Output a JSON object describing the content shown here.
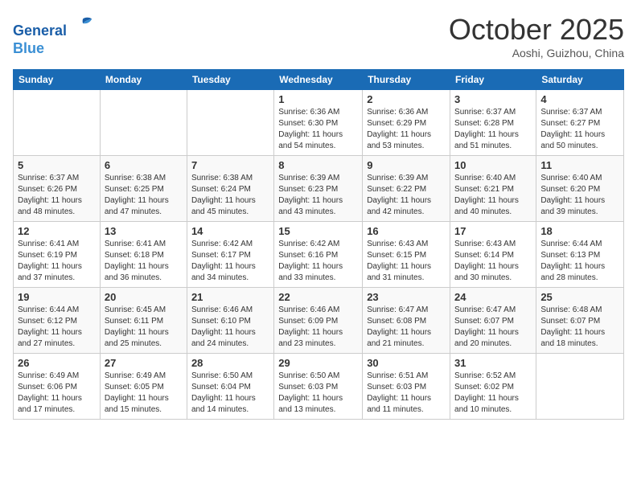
{
  "header": {
    "logo_line1": "General",
    "logo_line2": "Blue",
    "month": "October 2025",
    "location": "Aoshi, Guizhou, China"
  },
  "weekdays": [
    "Sunday",
    "Monday",
    "Tuesday",
    "Wednesday",
    "Thursday",
    "Friday",
    "Saturday"
  ],
  "weeks": [
    [
      {
        "day": "",
        "info": ""
      },
      {
        "day": "",
        "info": ""
      },
      {
        "day": "",
        "info": ""
      },
      {
        "day": "1",
        "info": "Sunrise: 6:36 AM\nSunset: 6:30 PM\nDaylight: 11 hours\nand 54 minutes."
      },
      {
        "day": "2",
        "info": "Sunrise: 6:36 AM\nSunset: 6:29 PM\nDaylight: 11 hours\nand 53 minutes."
      },
      {
        "day": "3",
        "info": "Sunrise: 6:37 AM\nSunset: 6:28 PM\nDaylight: 11 hours\nand 51 minutes."
      },
      {
        "day": "4",
        "info": "Sunrise: 6:37 AM\nSunset: 6:27 PM\nDaylight: 11 hours\nand 50 minutes."
      }
    ],
    [
      {
        "day": "5",
        "info": "Sunrise: 6:37 AM\nSunset: 6:26 PM\nDaylight: 11 hours\nand 48 minutes."
      },
      {
        "day": "6",
        "info": "Sunrise: 6:38 AM\nSunset: 6:25 PM\nDaylight: 11 hours\nand 47 minutes."
      },
      {
        "day": "7",
        "info": "Sunrise: 6:38 AM\nSunset: 6:24 PM\nDaylight: 11 hours\nand 45 minutes."
      },
      {
        "day": "8",
        "info": "Sunrise: 6:39 AM\nSunset: 6:23 PM\nDaylight: 11 hours\nand 43 minutes."
      },
      {
        "day": "9",
        "info": "Sunrise: 6:39 AM\nSunset: 6:22 PM\nDaylight: 11 hours\nand 42 minutes."
      },
      {
        "day": "10",
        "info": "Sunrise: 6:40 AM\nSunset: 6:21 PM\nDaylight: 11 hours\nand 40 minutes."
      },
      {
        "day": "11",
        "info": "Sunrise: 6:40 AM\nSunset: 6:20 PM\nDaylight: 11 hours\nand 39 minutes."
      }
    ],
    [
      {
        "day": "12",
        "info": "Sunrise: 6:41 AM\nSunset: 6:19 PM\nDaylight: 11 hours\nand 37 minutes."
      },
      {
        "day": "13",
        "info": "Sunrise: 6:41 AM\nSunset: 6:18 PM\nDaylight: 11 hours\nand 36 minutes."
      },
      {
        "day": "14",
        "info": "Sunrise: 6:42 AM\nSunset: 6:17 PM\nDaylight: 11 hours\nand 34 minutes."
      },
      {
        "day": "15",
        "info": "Sunrise: 6:42 AM\nSunset: 6:16 PM\nDaylight: 11 hours\nand 33 minutes."
      },
      {
        "day": "16",
        "info": "Sunrise: 6:43 AM\nSunset: 6:15 PM\nDaylight: 11 hours\nand 31 minutes."
      },
      {
        "day": "17",
        "info": "Sunrise: 6:43 AM\nSunset: 6:14 PM\nDaylight: 11 hours\nand 30 minutes."
      },
      {
        "day": "18",
        "info": "Sunrise: 6:44 AM\nSunset: 6:13 PM\nDaylight: 11 hours\nand 28 minutes."
      }
    ],
    [
      {
        "day": "19",
        "info": "Sunrise: 6:44 AM\nSunset: 6:12 PM\nDaylight: 11 hours\nand 27 minutes."
      },
      {
        "day": "20",
        "info": "Sunrise: 6:45 AM\nSunset: 6:11 PM\nDaylight: 11 hours\nand 25 minutes."
      },
      {
        "day": "21",
        "info": "Sunrise: 6:46 AM\nSunset: 6:10 PM\nDaylight: 11 hours\nand 24 minutes."
      },
      {
        "day": "22",
        "info": "Sunrise: 6:46 AM\nSunset: 6:09 PM\nDaylight: 11 hours\nand 23 minutes."
      },
      {
        "day": "23",
        "info": "Sunrise: 6:47 AM\nSunset: 6:08 PM\nDaylight: 11 hours\nand 21 minutes."
      },
      {
        "day": "24",
        "info": "Sunrise: 6:47 AM\nSunset: 6:07 PM\nDaylight: 11 hours\nand 20 minutes."
      },
      {
        "day": "25",
        "info": "Sunrise: 6:48 AM\nSunset: 6:07 PM\nDaylight: 11 hours\nand 18 minutes."
      }
    ],
    [
      {
        "day": "26",
        "info": "Sunrise: 6:49 AM\nSunset: 6:06 PM\nDaylight: 11 hours\nand 17 minutes."
      },
      {
        "day": "27",
        "info": "Sunrise: 6:49 AM\nSunset: 6:05 PM\nDaylight: 11 hours\nand 15 minutes."
      },
      {
        "day": "28",
        "info": "Sunrise: 6:50 AM\nSunset: 6:04 PM\nDaylight: 11 hours\nand 14 minutes."
      },
      {
        "day": "29",
        "info": "Sunrise: 6:50 AM\nSunset: 6:03 PM\nDaylight: 11 hours\nand 13 minutes."
      },
      {
        "day": "30",
        "info": "Sunrise: 6:51 AM\nSunset: 6:03 PM\nDaylight: 11 hours\nand 11 minutes."
      },
      {
        "day": "31",
        "info": "Sunrise: 6:52 AM\nSunset: 6:02 PM\nDaylight: 11 hours\nand 10 minutes."
      },
      {
        "day": "",
        "info": ""
      }
    ]
  ]
}
